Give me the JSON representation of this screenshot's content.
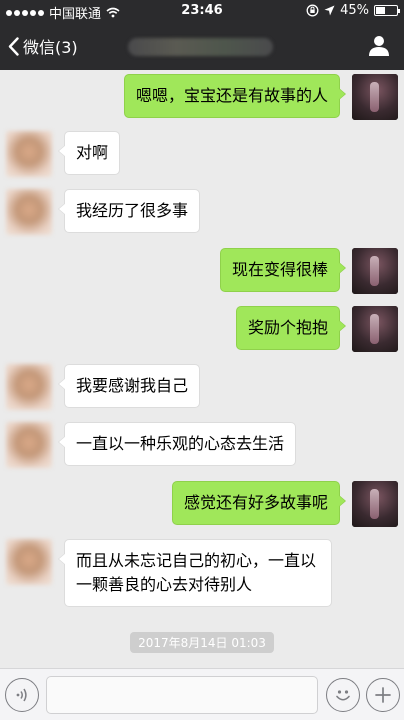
{
  "status_bar": {
    "carrier": "中国联通",
    "time": "23:46",
    "battery_percent": "45%",
    "battery_level": 0.45,
    "signal_icon": "signal-dots-icon",
    "wifi_icon": "wifi-icon",
    "lock_icon": "orientation-lock-icon",
    "location_icon": "location-arrow-icon"
  },
  "nav": {
    "back_label": "微信(3)",
    "back_icon": "chevron-left-icon",
    "profile_icon": "person-icon"
  },
  "messages": [
    {
      "side": "out",
      "text": "嗯嗯，宝宝还是有故事的人"
    },
    {
      "side": "in",
      "text": "对啊"
    },
    {
      "side": "in",
      "text": "我经历了很多事"
    },
    {
      "side": "out",
      "text": "现在变得很棒"
    },
    {
      "side": "out",
      "text": "奖励个抱抱"
    },
    {
      "side": "in",
      "text": "我要感谢我自己"
    },
    {
      "side": "in",
      "text": "一直以一种乐观的心态去生活"
    },
    {
      "side": "out",
      "text": "感觉还有好多故事呢"
    },
    {
      "side": "in",
      "text": "而且从未忘记自己的初心，一直以一颗善良的心去对待别人"
    }
  ],
  "timestamp": "2017年8月14日 01:03",
  "input_bar": {
    "voice_icon": "voice-icon",
    "emoji_icon": "emoji-icon",
    "plus_icon": "plus-icon",
    "input_value": ""
  },
  "colors": {
    "header_bg": "#2b2b2d",
    "chat_bg": "#ebebeb",
    "outgoing_bubble": "#a0e75a",
    "incoming_bubble": "#ffffff"
  }
}
